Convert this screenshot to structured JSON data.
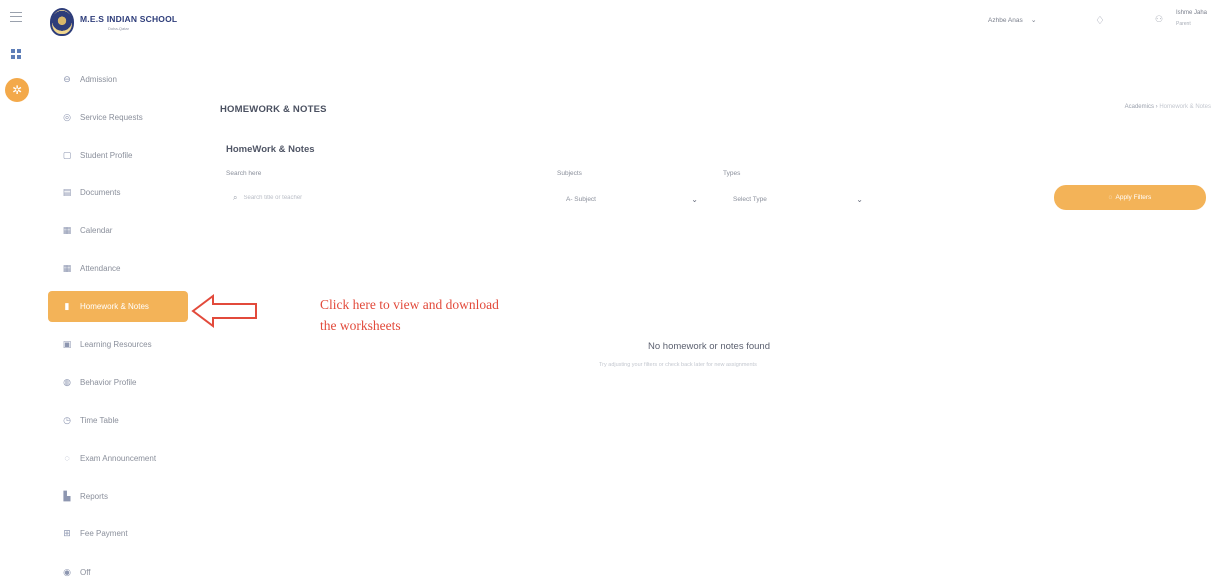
{
  "rail": {
    "menu_icon": "hamburger-icon",
    "grid_icon": "grid-icon",
    "active_icon": "apps-icon"
  },
  "header": {
    "school_name": "M.E.S INDIAN SCHOOL",
    "school_tagline": "Doha-Qatar",
    "child_selector": "Azhbe Anas",
    "notification_icon": "bulb-icon",
    "user_name": "Ishme Jaha",
    "user_role": "Parent"
  },
  "sidebar": {
    "items": [
      {
        "label": "Admission",
        "icon": "admission-icon"
      },
      {
        "label": "Service Requests",
        "icon": "service-icon"
      },
      {
        "label": "Student Profile",
        "icon": "profile-icon"
      },
      {
        "label": "Documents",
        "icon": "documents-icon"
      },
      {
        "label": "Calendar",
        "icon": "calendar-icon"
      },
      {
        "label": "Attendance",
        "icon": "attendance-icon"
      },
      {
        "label": "Homework & Notes",
        "icon": "book-icon",
        "active": true
      },
      {
        "label": "Learning Resources",
        "icon": "resources-icon"
      },
      {
        "label": "Behavior Profile",
        "icon": "behavior-icon"
      },
      {
        "label": "Time Table",
        "icon": "clock-icon"
      },
      {
        "label": "Exam Announcement",
        "icon": "bell-icon"
      },
      {
        "label": "Reports",
        "icon": "reports-icon"
      },
      {
        "label": "Fee Payment",
        "icon": "gift-icon"
      },
      {
        "label": "Off",
        "icon": "off-icon"
      }
    ]
  },
  "annotation": {
    "line1": "Click here to view and download",
    "line2": "the worksheets",
    "color": "#e24a3b"
  },
  "page": {
    "title": "HOMEWORK & NOTES",
    "breadcrumb_parent": "Academics",
    "breadcrumb_current": "Homework & Notes",
    "section_title": "HomeWork & Notes"
  },
  "filters": {
    "search_label": "Search here",
    "search_placeholder": "Search title or teacher",
    "subjects_label": "Subjects",
    "subject_value": "A- Subject",
    "types_label": "Types",
    "type_value": "Select Type",
    "apply_label": "Apply Filters"
  },
  "empty_state": {
    "title": "No homework or notes found",
    "subtitle": "Try adjusting your filters or check back later for new assignments"
  },
  "colors": {
    "accent": "#f3b358",
    "brand": "#2e3d7a"
  }
}
